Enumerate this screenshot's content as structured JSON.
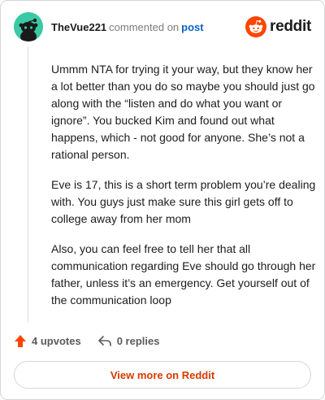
{
  "header": {
    "username": "TheVue221",
    "action_text": "commented on",
    "post_link": "post",
    "brand_name": "reddit"
  },
  "comment": {
    "paragraphs": [
      "Ummm NTA for trying it your way, but they know her a lot better than you do so maybe you should just go along with the “listen and do what you want or ignore”. You bucked Kim and found out what happens, which - not good for anyone. She’s not a rational person.",
      "Eve is 17, this is a short term problem you’re dealing with. You guys just make sure this girl gets off to college away from her mom",
      "Also, you can feel free to tell her that all communication regarding Eve should go through her father, unless it’s an emergency. Get yourself out of the communication loop"
    ]
  },
  "footer": {
    "upvotes_label": "4 upvotes",
    "replies_label": "0 replies"
  },
  "view_more_label": "View more on Reddit",
  "colors": {
    "accent": "#d93a00",
    "upvote": "#ff4500",
    "avatar_bg": "#3ac9a4",
    "link": "#0b63c6"
  },
  "icons": {
    "avatar": "snoo-avatar-icon",
    "brand": "reddit-logo-icon",
    "upvote": "upvote-arrow-icon",
    "reply": "reply-arrow-icon"
  }
}
